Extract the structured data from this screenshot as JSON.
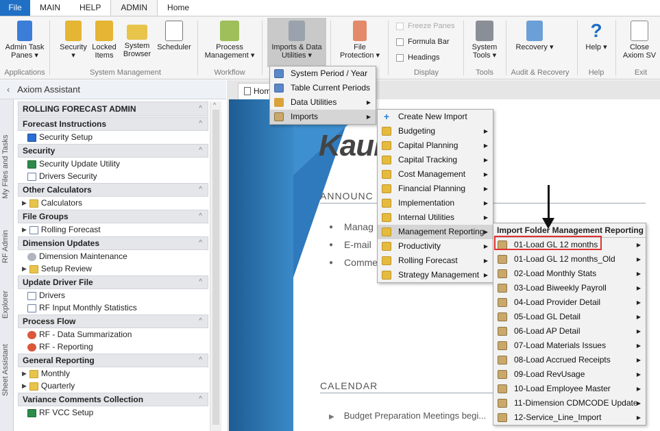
{
  "tabs": [
    "File",
    "MAIN",
    "HELP",
    "ADMIN",
    "Home"
  ],
  "ribbon": {
    "admin_task_panes": "Admin Task Panes ▾",
    "security": "Security ▾",
    "locked_items": "Locked Items",
    "system_browser": "System Browser",
    "scheduler": "Scheduler",
    "process_management": "Process Management ▾",
    "imports_utilities": "Imports & Data Utilities ▾",
    "file_protection": "File Protection ▾",
    "freeze_panes": "Freeze Panes",
    "formula_bar": "Formula Bar",
    "headings": "Headings",
    "system_tools": "System Tools ▾",
    "recovery": "Recovery ▾",
    "help": "Help ▾",
    "close": "Close Axiom SV",
    "groups": {
      "applications": "Applications",
      "system_management": "System Management",
      "workflow": "Workflow",
      "display": "Display",
      "tools": "Tools",
      "audit_recovery": "Audit & Recovery",
      "help": "Help",
      "exit": "Exit"
    }
  },
  "assistant": {
    "title": "Axiom Assistant",
    "header": "ROLLING FORECAST ADMIN",
    "sections": {
      "forecast_instructions": "Forecast Instructions",
      "security": "Security",
      "other_calculators": "Other Calculators",
      "file_groups": "File Groups",
      "dimension_updates": "Dimension Updates",
      "update_driver_file": "Update Driver File",
      "process_flow": "Process Flow",
      "general_reporting": "General Reporting",
      "variance_comments": "Variance Comments Collection"
    },
    "items": {
      "security_setup": "Security Setup",
      "security_update_utility": "Security Update Utility",
      "drivers_security": "Drivers Security",
      "calculators": "Calculators",
      "rolling_forecast": "Rolling Forecast",
      "dimension_maintenance": "Dimension Maintenance",
      "setup_review": "Setup Review",
      "drivers": "Drivers",
      "rf_input_monthly": "RF Input Monthly Statistics",
      "rf_data_summarization": "RF - Data Summarization",
      "rf_reporting": "RF - Reporting",
      "monthly": "Monthly",
      "quarterly": "Quarterly",
      "rf_vcc_setup": "RF VCC Setup"
    }
  },
  "side_tabs": [
    "My Files and Tasks",
    "RF Admin",
    "Explorer",
    "Sheet Assistant"
  ],
  "doc_tab": "Home",
  "home": {
    "logo": "Kaui",
    "announcements": "ANNOUNC",
    "bullets": [
      "Manag",
      "E-mail",
      "Comme"
    ],
    "calendar": "CALENDAR",
    "calendar_item": "Budget Preparation Meetings begi..."
  },
  "menu1": [
    "System Period / Year",
    "Table Current Periods",
    "Data Utilities",
    "Imports"
  ],
  "menu2": [
    "Create New Import",
    "Budgeting",
    "Capital Planning",
    "Capital Tracking",
    "Cost Management",
    "Financial Planning",
    "Implementation",
    "Internal Utilities",
    "Management Reporting",
    "Productivity",
    "Rolling Forecast",
    "Strategy Management"
  ],
  "menu3": {
    "header": "Import Folder Management Reporting",
    "items": [
      "01-Load GL 12 months",
      "01-Load GL 12 months_Old",
      "02-Load Monthly Stats",
      "03-Load Biweekly Payroll",
      "04-Load Provider Detail",
      "05-Load GL Detail",
      "06-Load AP Detail",
      "07-Load Materials Issues",
      "08-Load Accrued Receipts",
      "09-Load RevUsage",
      "10-Load Employee Master",
      "11-Dimension CDMCODE Update",
      "12-Service_Line_Import"
    ]
  }
}
